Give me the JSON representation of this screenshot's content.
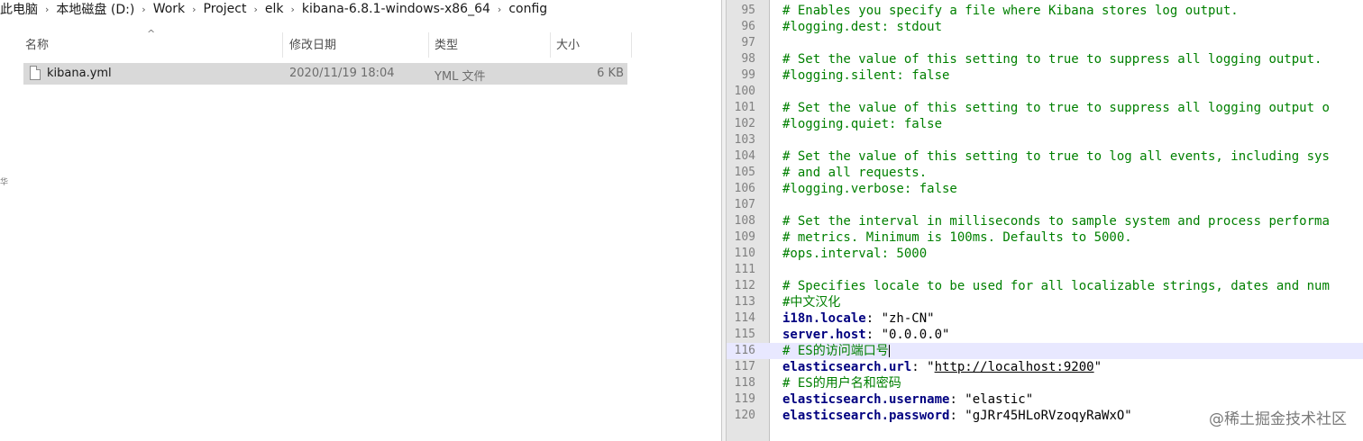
{
  "breadcrumb": [
    "此电脑",
    "本地磁盘 (D:)",
    "Work",
    "Project",
    "elk",
    "kibana-6.8.1-windows-x86_64",
    "config"
  ],
  "columns": {
    "name": "名称",
    "modified": "修改日期",
    "type": "类型",
    "size": "大小"
  },
  "file": {
    "name": "kibana.yml",
    "modified": "2020/11/19 18:04",
    "type": "YML 文件",
    "size": "6 KB"
  },
  "left_glyph": "华",
  "editor": {
    "current_line": 116,
    "lines": [
      {
        "n": "95",
        "parts": [
          {
            "t": "# Enables you specify a file where Kibana stores log output.",
            "c": "comment"
          }
        ]
      },
      {
        "n": "96",
        "parts": [
          {
            "t": "#logging.dest: stdout",
            "c": "comment"
          }
        ]
      },
      {
        "n": "97",
        "parts": []
      },
      {
        "n": "98",
        "parts": [
          {
            "t": "# Set the value of this setting to true to suppress all logging output.",
            "c": "comment"
          }
        ]
      },
      {
        "n": "99",
        "parts": [
          {
            "t": "#logging.silent: false",
            "c": "comment"
          }
        ]
      },
      {
        "n": "100",
        "parts": []
      },
      {
        "n": "101",
        "parts": [
          {
            "t": "# Set the value of this setting to true to suppress all logging output o",
            "c": "comment"
          }
        ]
      },
      {
        "n": "102",
        "parts": [
          {
            "t": "#logging.quiet: false",
            "c": "comment"
          }
        ]
      },
      {
        "n": "103",
        "parts": []
      },
      {
        "n": "104",
        "parts": [
          {
            "t": "# Set the value of this setting to true to log all events, including sys",
            "c": "comment"
          }
        ]
      },
      {
        "n": "105",
        "parts": [
          {
            "t": "# and all requests.",
            "c": "comment"
          }
        ]
      },
      {
        "n": "106",
        "parts": [
          {
            "t": "#logging.verbose: false",
            "c": "comment"
          }
        ]
      },
      {
        "n": "107",
        "parts": []
      },
      {
        "n": "108",
        "parts": [
          {
            "t": "# Set the interval in milliseconds to sample system and process performa",
            "c": "comment"
          }
        ]
      },
      {
        "n": "109",
        "parts": [
          {
            "t": "# metrics. Minimum is 100ms. Defaults to 5000.",
            "c": "comment"
          }
        ]
      },
      {
        "n": "110",
        "parts": [
          {
            "t": "#ops.interval: 5000",
            "c": "comment"
          }
        ]
      },
      {
        "n": "111",
        "parts": []
      },
      {
        "n": "112",
        "parts": [
          {
            "t": "# Specifies locale to be used for all localizable strings, dates and num",
            "c": "comment"
          }
        ]
      },
      {
        "n": "113",
        "parts": [
          {
            "t": "#中文汉化",
            "c": "comment"
          }
        ]
      },
      {
        "n": "114",
        "parts": [
          {
            "t": "i18n.locale",
            "c": "key"
          },
          {
            "t": ": ",
            "c": "punct"
          },
          {
            "t": "\"zh-CN\"",
            "c": "str"
          }
        ]
      },
      {
        "n": "115",
        "parts": [
          {
            "t": "server.host",
            "c": "key"
          },
          {
            "t": ": ",
            "c": "punct"
          },
          {
            "t": "\"0.0.0.0\"",
            "c": "str"
          }
        ]
      },
      {
        "n": "116",
        "parts": [
          {
            "t": "# ES的访问端口号",
            "c": "comment"
          }
        ]
      },
      {
        "n": "117",
        "parts": [
          {
            "t": "elasticsearch.url",
            "c": "key"
          },
          {
            "t": ": ",
            "c": "punct"
          },
          {
            "t": "\"",
            "c": "str"
          },
          {
            "t": "http://localhost:9200",
            "c": "url"
          },
          {
            "t": "\"",
            "c": "str"
          }
        ]
      },
      {
        "n": "118",
        "parts": [
          {
            "t": "# ES的用户名和密码",
            "c": "comment"
          }
        ]
      },
      {
        "n": "119",
        "parts": [
          {
            "t": "elasticsearch.username",
            "c": "key"
          },
          {
            "t": ": ",
            "c": "punct"
          },
          {
            "t": "\"elastic\"",
            "c": "str"
          }
        ]
      },
      {
        "n": "120",
        "parts": [
          {
            "t": "elasticsearch.password",
            "c": "key"
          },
          {
            "t": ": ",
            "c": "punct"
          },
          {
            "t": "\"gJRr45HLoRVzoqyRaWxO\"",
            "c": "str"
          }
        ]
      }
    ]
  },
  "watermark": "@稀土掘金技术社区"
}
